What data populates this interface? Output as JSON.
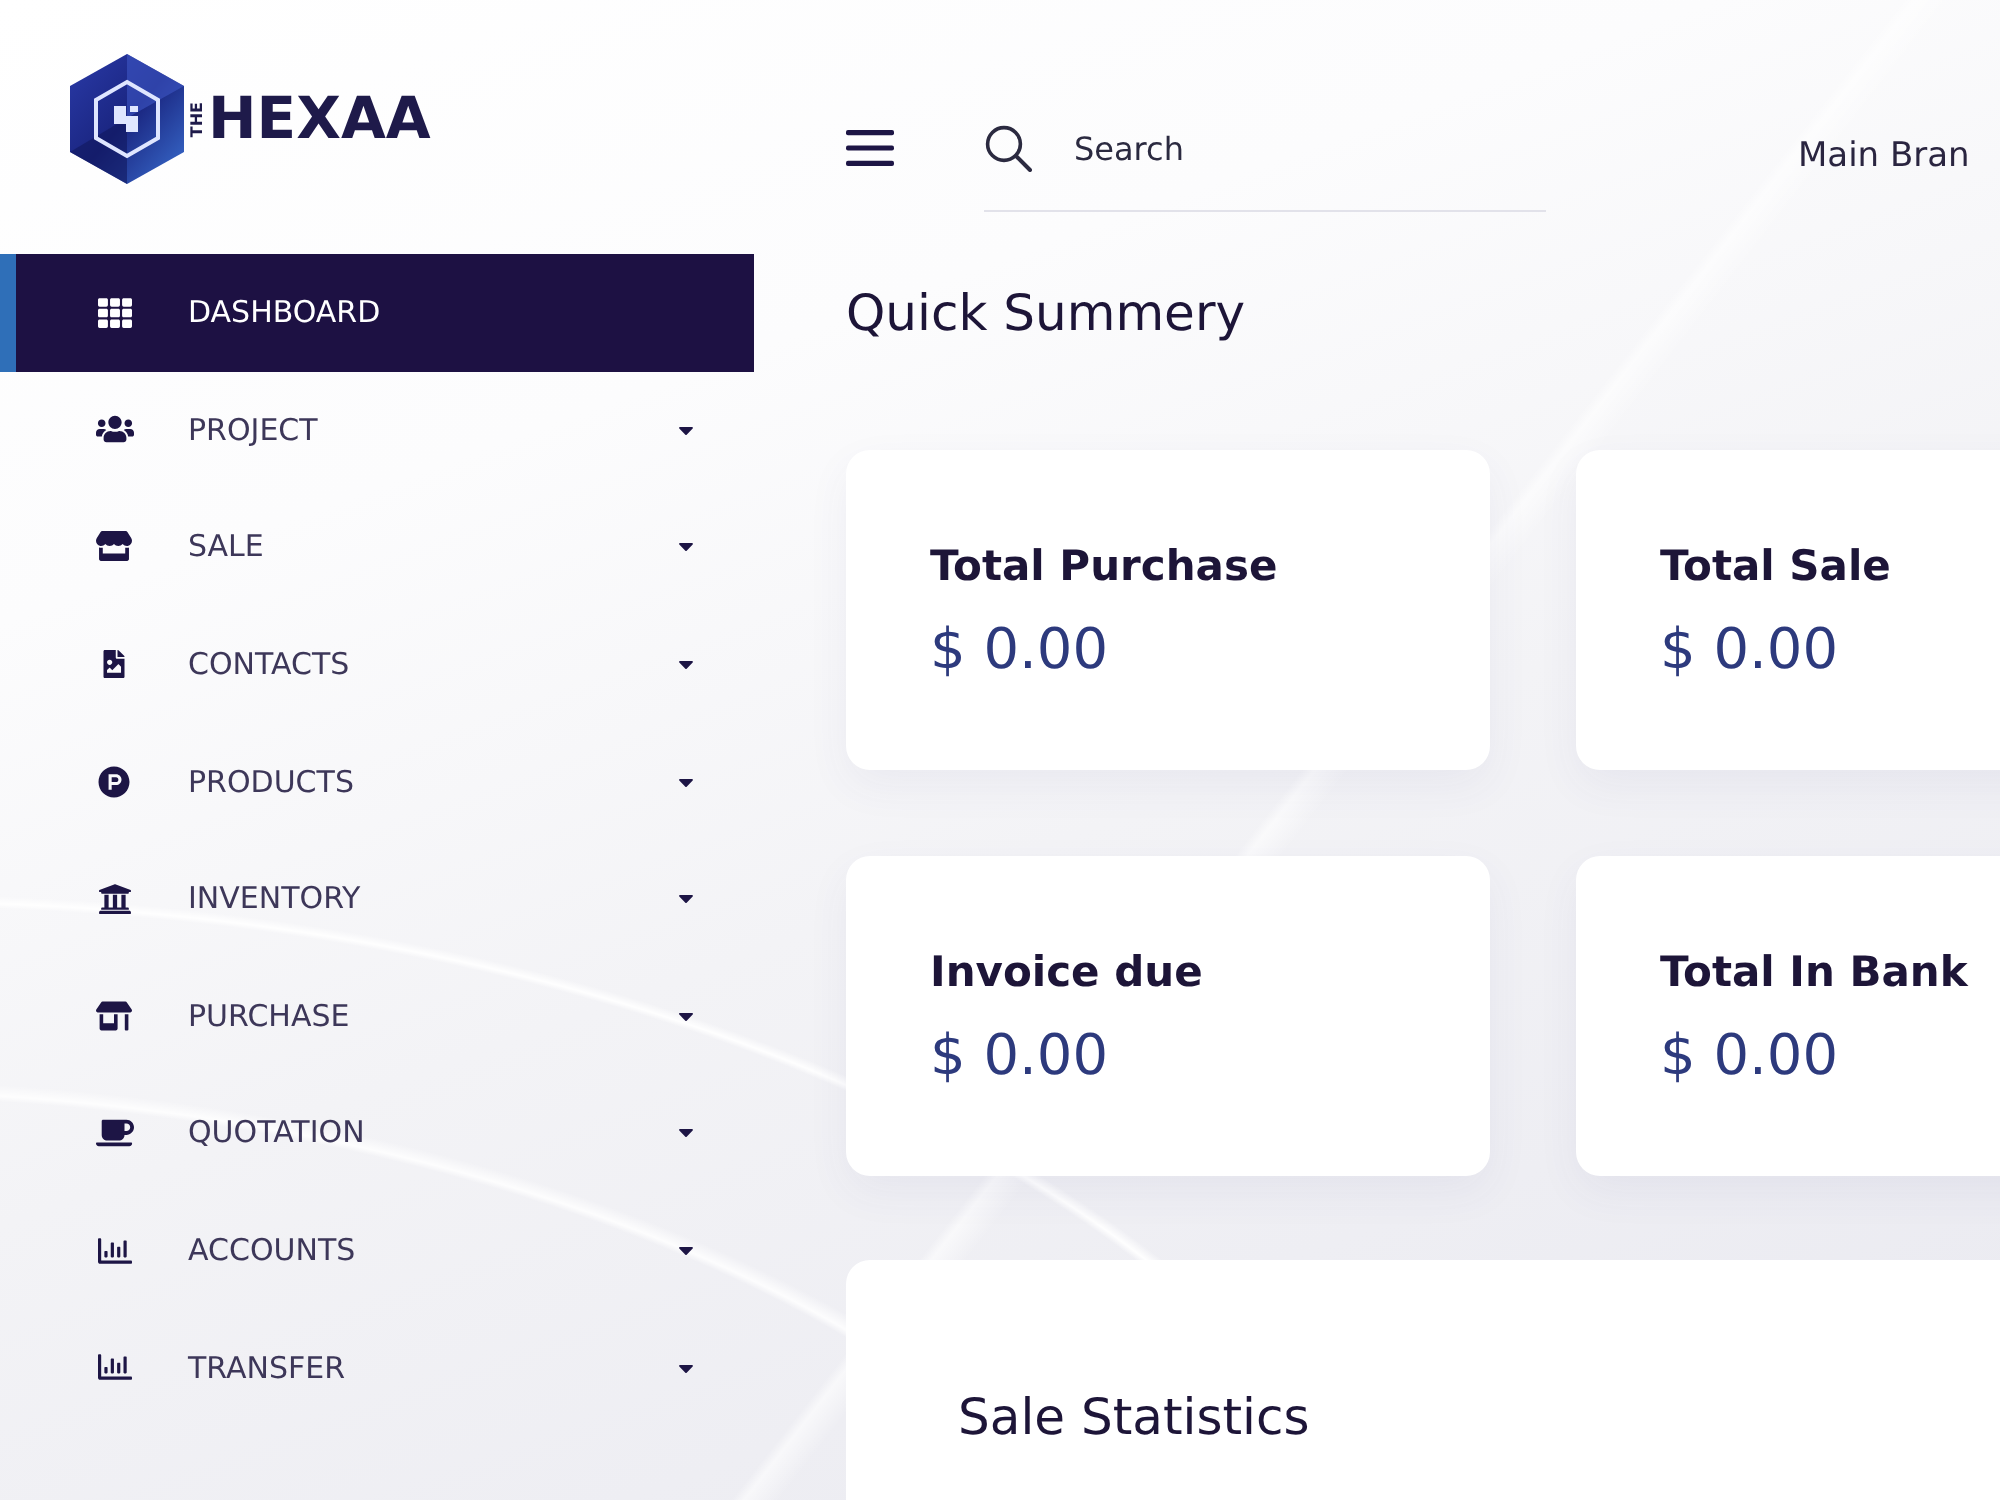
{
  "logo": {
    "prefix": "THE",
    "name": "HEXAA"
  },
  "sidebar": {
    "items": [
      {
        "label": "DASHBOARD",
        "selected": true,
        "has_submenu": false
      },
      {
        "label": "PROJECT",
        "selected": false,
        "has_submenu": true
      },
      {
        "label": "SALE",
        "selected": false,
        "has_submenu": true
      },
      {
        "label": "CONTACTS",
        "selected": false,
        "has_submenu": true
      },
      {
        "label": "PRODUCTS",
        "selected": false,
        "has_submenu": true
      },
      {
        "label": "INVENTORY",
        "selected": false,
        "has_submenu": true
      },
      {
        "label": "PURCHASE",
        "selected": false,
        "has_submenu": true
      },
      {
        "label": "QUOTATION",
        "selected": false,
        "has_submenu": true
      },
      {
        "label": "ACCOUNTS",
        "selected": false,
        "has_submenu": true
      },
      {
        "label": "TRANSFER",
        "selected": false,
        "has_submenu": true
      }
    ]
  },
  "header": {
    "search": {
      "placeholder": "Search"
    },
    "branch": "Main Bran"
  },
  "page_title": "Quick Summery",
  "summary_cards": [
    {
      "title": "Total Purchase",
      "value": "$ 0.00"
    },
    {
      "title": "Total Sale",
      "value": "$ 0.00"
    },
    {
      "title": "Invoice due",
      "value": "$ 0.00"
    },
    {
      "title": "Total In Bank",
      "value": "$ 0.00"
    }
  ],
  "statistics": {
    "title": "Sale Statistics"
  }
}
